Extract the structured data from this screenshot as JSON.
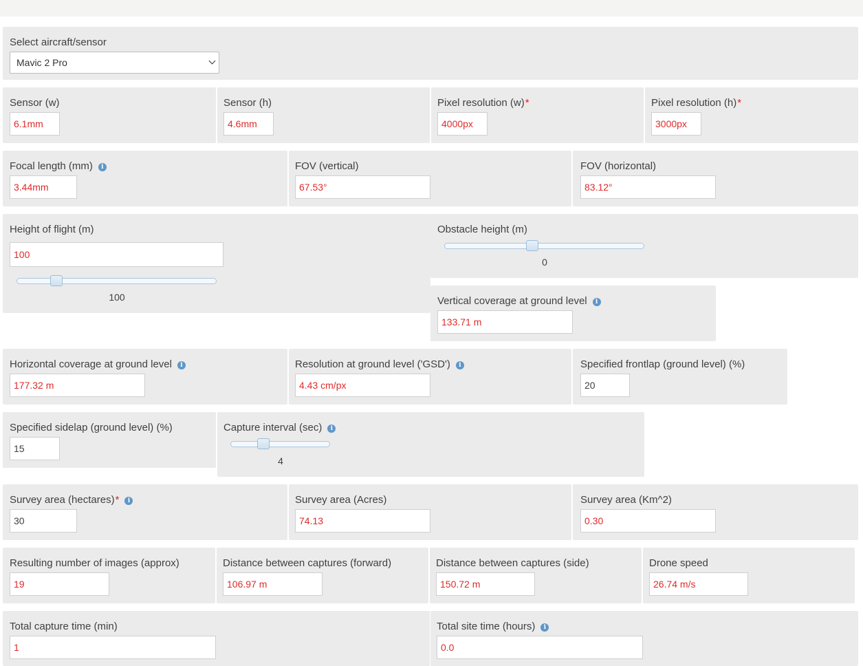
{
  "aircraft": {
    "label": "Select aircraft/sensor",
    "selected": "Mavic 2 Pro"
  },
  "sensor_w": {
    "label": "Sensor (w)",
    "value": "6.1mm"
  },
  "sensor_h": {
    "label": "Sensor (h)",
    "value": "4.6mm"
  },
  "pixel_w": {
    "label": "Pixel resolution (w)",
    "required": "*",
    "value": "4000px"
  },
  "pixel_h": {
    "label": "Pixel resolution (h)",
    "required": "*",
    "value": "3000px"
  },
  "focal": {
    "label": "Focal length (mm)",
    "value": "3.44mm",
    "info": "i"
  },
  "fov_v": {
    "label": "FOV (vertical)",
    "value": "67.53°"
  },
  "fov_h": {
    "label": "FOV (horizontal)",
    "value": "83.12°"
  },
  "height": {
    "label": "Height of flight (m)",
    "value": "100",
    "slider_value": "100",
    "slider_level": 0.2
  },
  "obstacle": {
    "label": "Obstacle height (m)",
    "slider_value": "0",
    "slider_level": 0.44
  },
  "vcov": {
    "label": "Vertical coverage at ground level",
    "value": "133.71 m",
    "info": "i"
  },
  "hcov": {
    "label": "Horizontal coverage at ground level",
    "value": "177.32 m",
    "info": "i"
  },
  "gsd": {
    "label": "Resolution at ground level ('GSD')",
    "value": "4.43 cm/px",
    "info": "i"
  },
  "frontlap": {
    "label": "Specified frontlap (ground level) (%)",
    "value": "20"
  },
  "sidelap": {
    "label": "Specified sidelap (ground level) (%)",
    "value": "15"
  },
  "interval": {
    "label": "Capture interval (sec)",
    "slider_value": "4",
    "slider_level": 0.33,
    "info": "i"
  },
  "area_ha": {
    "label": "Survey area (hectares)",
    "required": "*",
    "value": "30",
    "info": "i"
  },
  "area_ac": {
    "label": "Survey area (Acres)",
    "value": "74.13"
  },
  "area_km": {
    "label": "Survey area (Km^2)",
    "value": "0.30"
  },
  "images": {
    "label": "Resulting number of images (approx)",
    "value": "19"
  },
  "dist_fwd": {
    "label": "Distance between captures (forward)",
    "value": "106.97 m"
  },
  "dist_side": {
    "label": "Distance between captures (side)",
    "value": "150.72 m"
  },
  "speed": {
    "label": "Drone speed",
    "value": "26.74 m/s"
  },
  "capture_time": {
    "label": "Total capture time (min)",
    "value": "1"
  },
  "site_time": {
    "label": "Total site time (hours)",
    "value": "0.0",
    "info": "i"
  },
  "colors": {
    "output_text": "#e02a2a",
    "panel_bg": "#ebebeb",
    "info_icon": "#5f97c8",
    "required": "#e02020"
  }
}
